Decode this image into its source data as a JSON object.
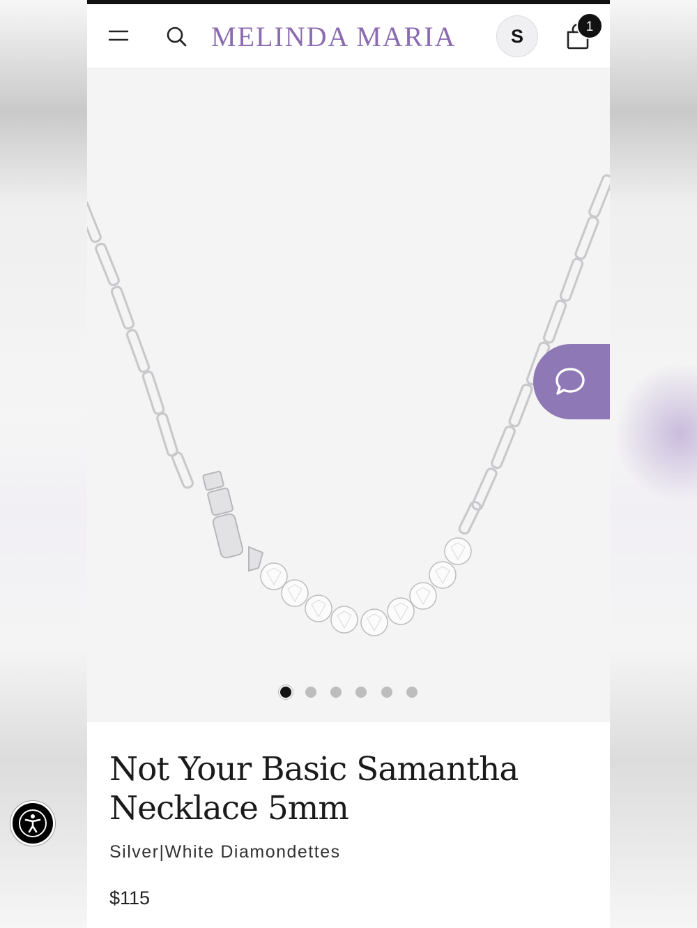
{
  "header": {
    "brand": "MELINDA MARIA",
    "menu_icon": "hamburger-menu-icon",
    "search_icon": "search-icon",
    "avatar_initial": "S",
    "cart_icon": "shopping-bag-icon",
    "cart_count": "1"
  },
  "gallery": {
    "image_alt": "Not Your Basic Samantha Necklace 5mm",
    "total_images": 6,
    "active_index": 0
  },
  "chat": {
    "icon": "chat-bubble-icon"
  },
  "accessibility": {
    "icon": "accessibility-person-icon"
  },
  "product": {
    "title": "Not Your Basic Samantha Necklace 5mm",
    "variant": "Silver|White Diamondettes",
    "price": "$115"
  },
  "colors": {
    "brand_purple": "#8b6bb1",
    "chat_purple": "#8e78b5",
    "text_dark": "#1a1a1a",
    "gallery_bg": "#f4f4f4"
  }
}
